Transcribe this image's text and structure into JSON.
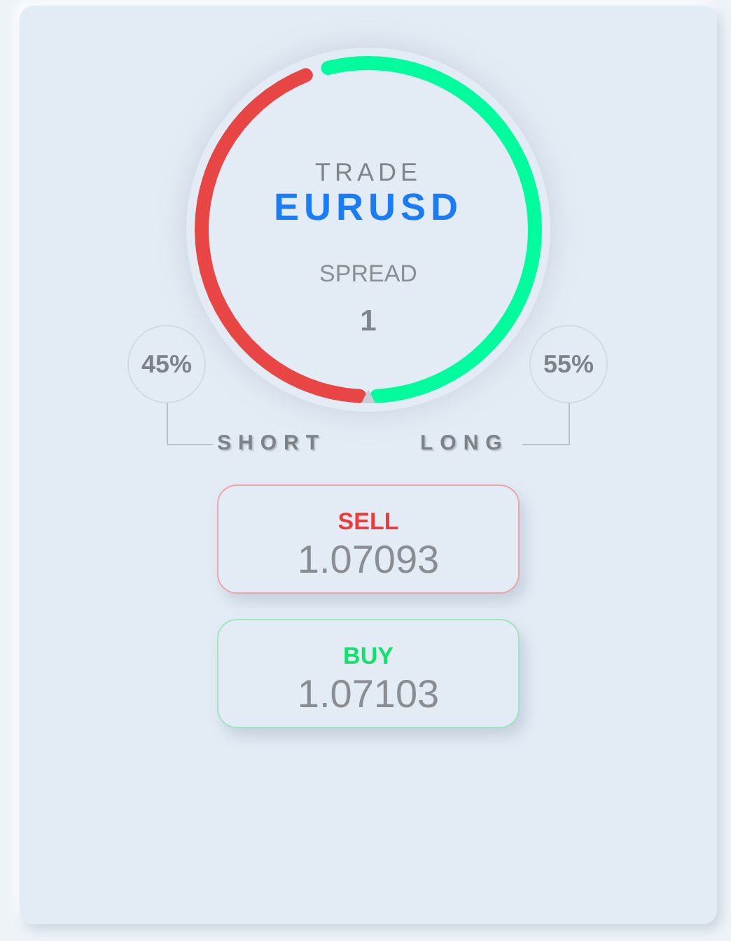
{
  "gauge": {
    "title": "TRADE",
    "symbol": "EURUSD",
    "spread_label": "SPREAD",
    "spread": "1"
  },
  "sides": [
    {
      "kind": "short",
      "percent": "45%",
      "label": "SHORT"
    },
    {
      "kind": "long",
      "percent": "55%",
      "label": "LONG"
    }
  ],
  "quotes": [
    {
      "kind": "sell",
      "label": "SELL",
      "price": "1.07093"
    },
    {
      "kind": "buy",
      "label": "BUY",
      "price": "1.07103"
    }
  ]
}
